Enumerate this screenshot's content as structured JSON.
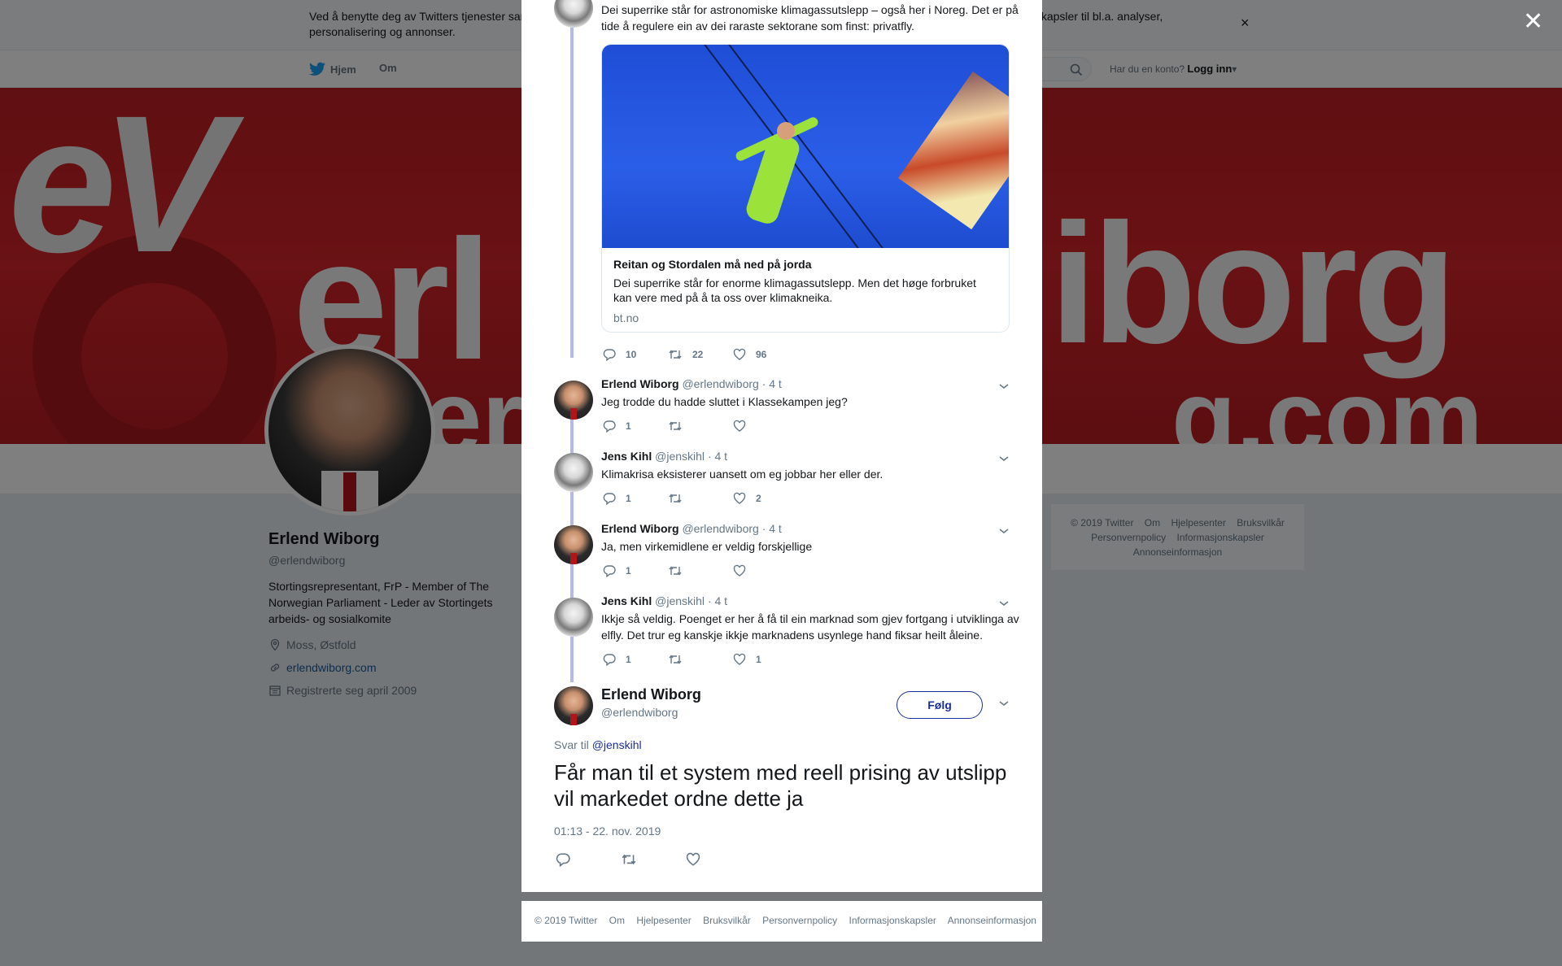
{
  "cookie": {
    "text": "Ved å benytte deg av Twitters tjenester samtykker du til vår bruk av informasjonskapsler. Vi og våre partnere driver globalt og bruker informasjonskapsler til bl.a. analyser, personalisering og annonser.",
    "close": "×"
  },
  "nav": {
    "home": "Hjem",
    "about": "Om",
    "account_q": "Har du en konto?",
    "login": "Logg inn"
  },
  "banner": {
    "logo": "eV",
    "word1": "erl",
    "word2": "iborg",
    "word3": "er",
    "word4": "g.com"
  },
  "profile": {
    "name": "Erlend Wiborg",
    "handle": "@erlendwiborg",
    "bio": "Stortingsrepresentant, FrP - Member of The Norwegian Parliament - Leder av Stortingets arbeids- og sosialkomite",
    "location": "Moss, Østfold",
    "website": "erlendwiborg.com",
    "joined": "Registrerte seg april 2009"
  },
  "side_footer": {
    "links": [
      "© 2019 Twitter",
      "Om",
      "Hjelpesenter",
      "Bruksvilkår",
      "Personvernpolicy",
      "Informasjonskapsler",
      "Annonseinformasjon"
    ]
  },
  "overlay_close": "✕",
  "thread": {
    "first": {
      "text": "Dei superrike står for astronomiske klimagassutslepp – også her i Noreg. Det er på tide å regulere ein av dei raraste sektorane som finst: privatfly.",
      "card": {
        "title": "Reitan og Stordalen må ned på jorda",
        "desc": "Dei superrike står for enorme klimagassutslepp. Men det høge forbruket kan vere med på å ta oss over klimakneika.",
        "url": "bt.no"
      },
      "replies": "10",
      "retweets": "22",
      "likes": "96"
    },
    "tweets": [
      {
        "name": "Erlend Wiborg",
        "handle": "@erlendwiborg",
        "time": "· 4 t",
        "text": "Jeg trodde du hadde sluttet i Klassekampen jeg?",
        "replies": "1",
        "retweets": "",
        "likes": ""
      },
      {
        "name": "Jens Kihl",
        "handle": "@jenskihl",
        "time": "· 4 t",
        "text": "Klimakrisa eksisterer uansett om eg jobbar her eller der.",
        "replies": "1",
        "retweets": "",
        "likes": "2"
      },
      {
        "name": "Erlend Wiborg",
        "handle": "@erlendwiborg",
        "time": "· 4 t",
        "text": "Ja, men virkemidlene er veldig forskjellige",
        "replies": "1",
        "retweets": "",
        "likes": ""
      },
      {
        "name": "Jens Kihl",
        "handle": "@jenskihl",
        "time": "· 4 t",
        "text": "Ikkje så veldig. Poenget er her å få til ein marknad som gjev fortgang i utviklinga av elfly. Det trur eg kanskje ikkje marknadens usynlege hand fiksar heilt åleine.",
        "replies": "1",
        "retweets": "",
        "likes": "1"
      }
    ],
    "main": {
      "name": "Erlend Wiborg",
      "handle": "@erlendwiborg",
      "follow": "Følg",
      "reply_prefix": "Svar til",
      "reply_to": "@jenskihl",
      "text": "Får man til et system med reell prising av utslipp vil markedet ordne dette ja",
      "timestamp": "01:13 - 22. nov. 2019"
    }
  },
  "modal_footer": {
    "links": [
      "© 2019 Twitter",
      "Om",
      "Hjelpesenter",
      "Bruksvilkår",
      "Personvernpolicy",
      "Informasjonskapsler",
      "Annonseinformasjon"
    ]
  },
  "colors": {
    "link": "#1b2f9a",
    "thread_line": "#b6b9e6",
    "banner_red": "#c01e24"
  }
}
